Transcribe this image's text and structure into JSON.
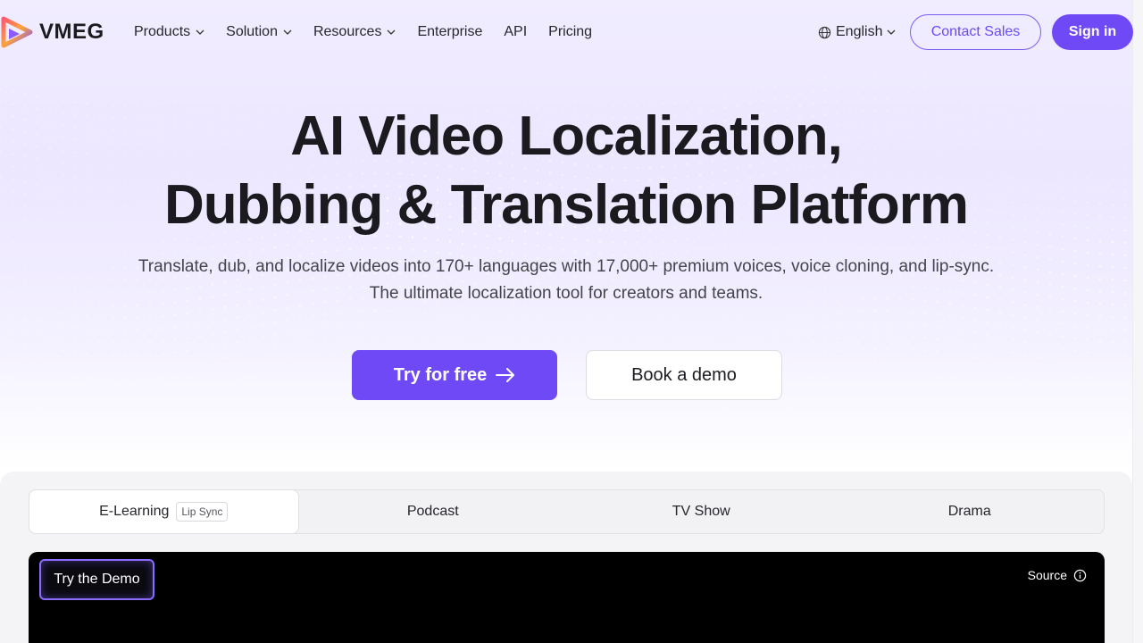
{
  "brand": {
    "name": "VMEG",
    "logo_icon": "play-triangle-logo",
    "accent": "#7049f6"
  },
  "nav": {
    "items": [
      {
        "label": "Products",
        "has_dropdown": true
      },
      {
        "label": "Solution",
        "has_dropdown": true
      },
      {
        "label": "Resources",
        "has_dropdown": true
      },
      {
        "label": "Enterprise",
        "has_dropdown": false
      },
      {
        "label": "API",
        "has_dropdown": false
      },
      {
        "label": "Pricing",
        "has_dropdown": false
      }
    ],
    "language": "English",
    "contact_label": "Contact Sales",
    "signin_label": "Sign in"
  },
  "hero": {
    "title_line1": "AI Video Localization,",
    "title_line2": "Dubbing & Translation Platform",
    "sub_line1": "Translate, dub, and localize videos into 170+ languages with 17,000+ premium voices, voice cloning, and lip-sync.",
    "sub_line2": "The ultimate localization tool for creators and teams.",
    "try_label": "Try for free",
    "demo_label": "Book a demo"
  },
  "demo": {
    "tabs": [
      {
        "label": "E-Learning",
        "badge": "Lip Sync",
        "active": true
      },
      {
        "label": "Podcast",
        "active": false
      },
      {
        "label": "TV Show",
        "active": false
      },
      {
        "label": "Drama",
        "active": false
      }
    ],
    "try_demo_label": "Try the Demo",
    "source_label": "Source"
  }
}
